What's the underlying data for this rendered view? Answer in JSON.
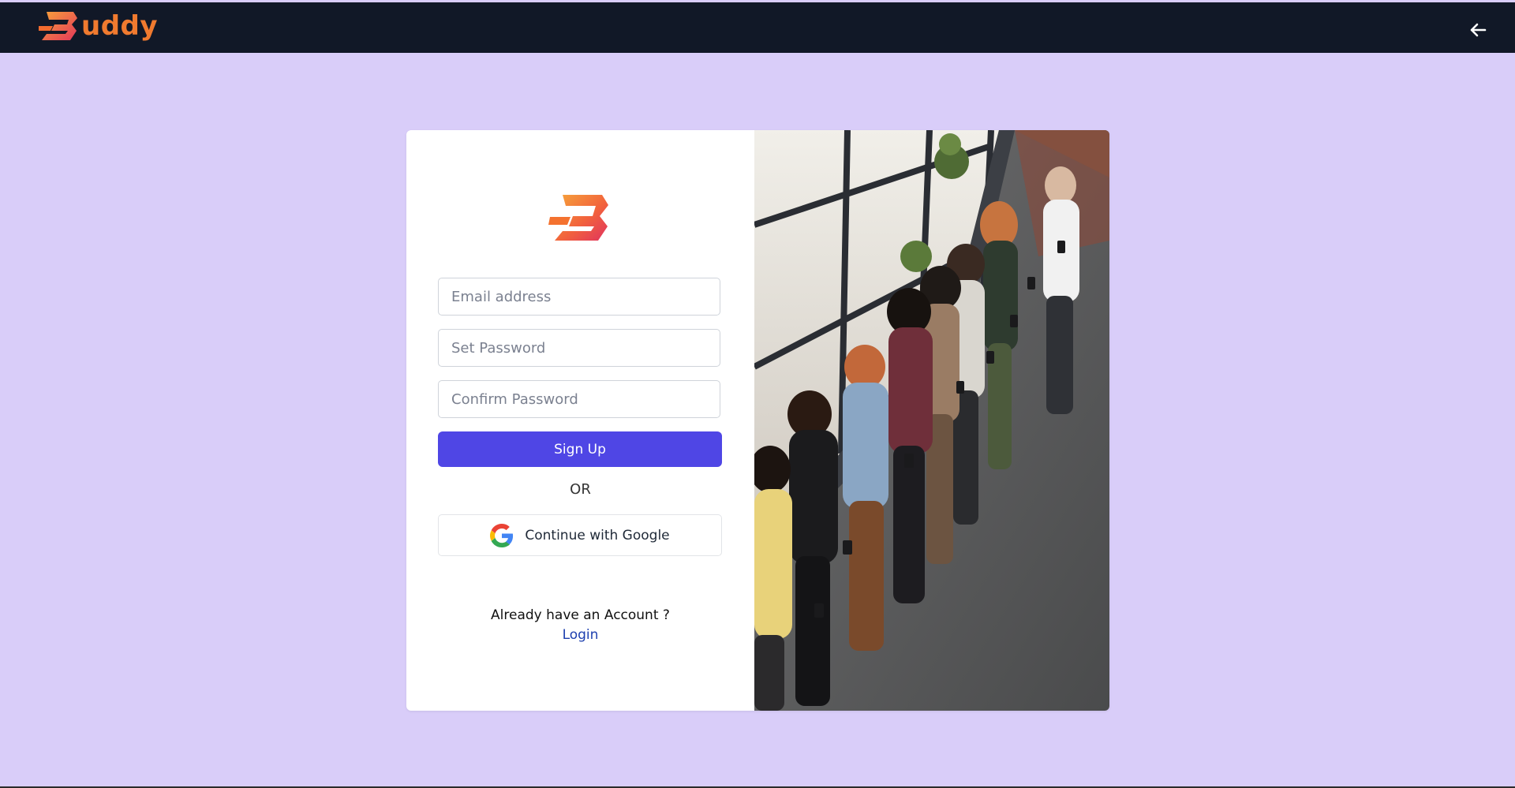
{
  "brand": {
    "name": "uddy",
    "accent_color": "#f07a2f"
  },
  "header": {
    "back_icon": "arrow-left-icon"
  },
  "form": {
    "email_placeholder": "Email address",
    "password_placeholder": "Set Password",
    "confirm_placeholder": "Confirm Password",
    "signup_label": "Sign Up",
    "or_label": "OR",
    "google_label": "Continue with Google",
    "already_text": "Already have an Account ?",
    "login_label": "Login",
    "primary_color": "#4f46e5"
  },
  "colors": {
    "page_bg": "#d9cdf9",
    "header_bg": "#111827",
    "link": "#1e40af"
  }
}
